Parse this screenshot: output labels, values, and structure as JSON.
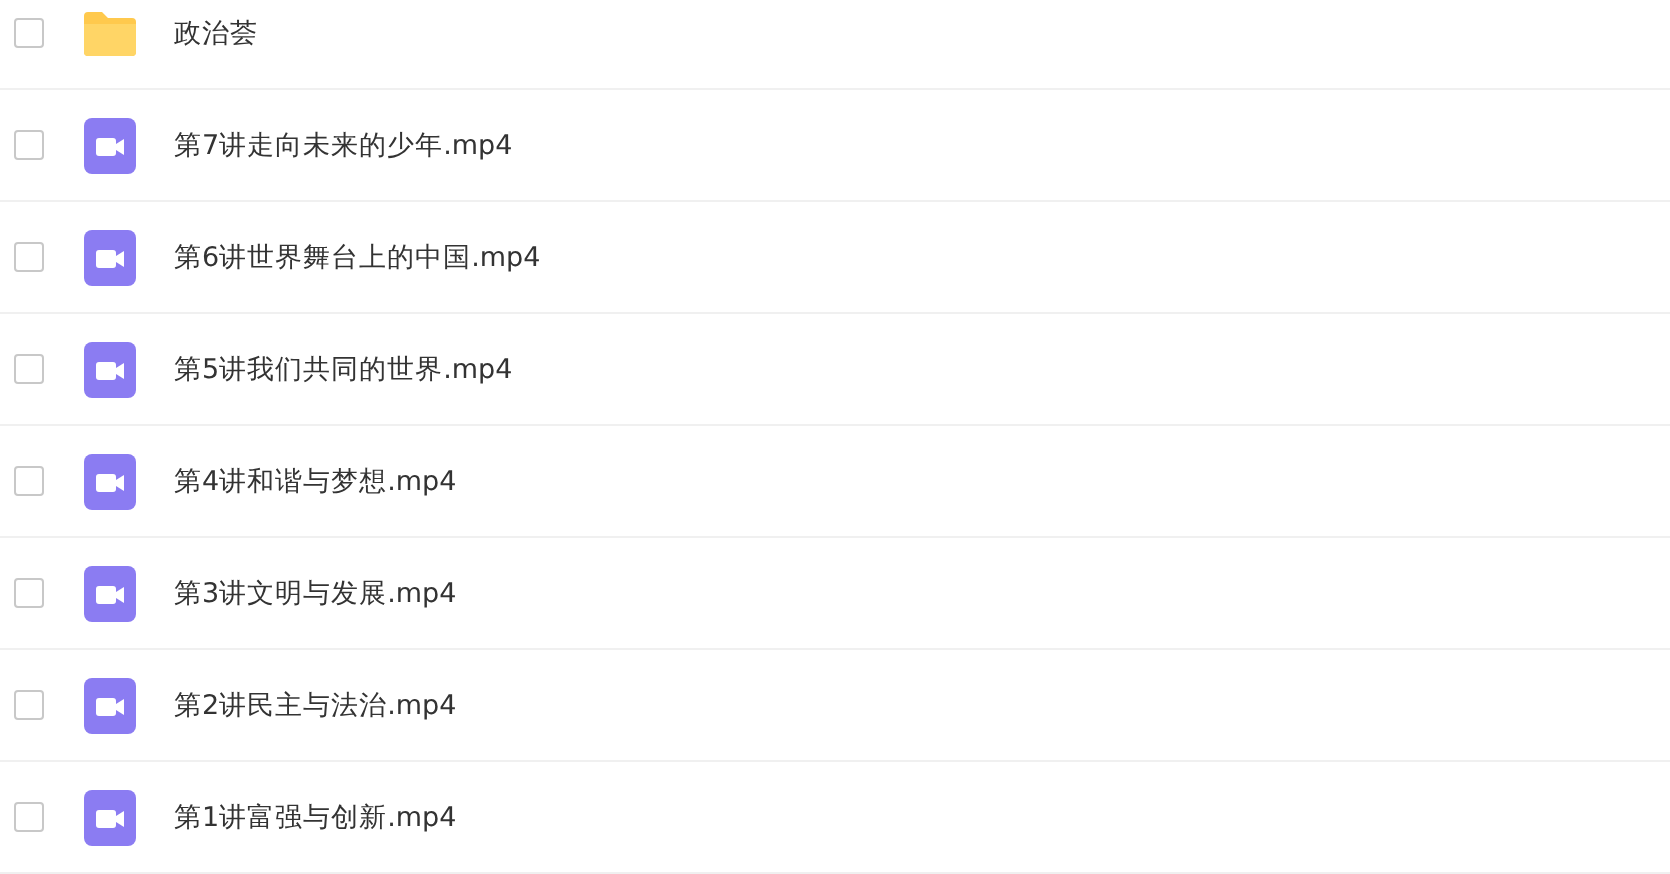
{
  "files": [
    {
      "kind": "folder",
      "name": "政治荟",
      "checked": false
    },
    {
      "kind": "video",
      "name": "第7讲走向未来的少年.mp4",
      "checked": false
    },
    {
      "kind": "video",
      "name": "第6讲世界舞台上的中国.mp4",
      "checked": false
    },
    {
      "kind": "video",
      "name": "第5讲我们共同的世界.mp4",
      "checked": false
    },
    {
      "kind": "video",
      "name": "第4讲和谐与梦想.mp4",
      "checked": false
    },
    {
      "kind": "video",
      "name": "第3讲文明与发展.mp4",
      "checked": false
    },
    {
      "kind": "video",
      "name": "第2讲民主与法治.mp4",
      "checked": false
    },
    {
      "kind": "video",
      "name": "第1讲富强与创新.mp4",
      "checked": false
    }
  ]
}
